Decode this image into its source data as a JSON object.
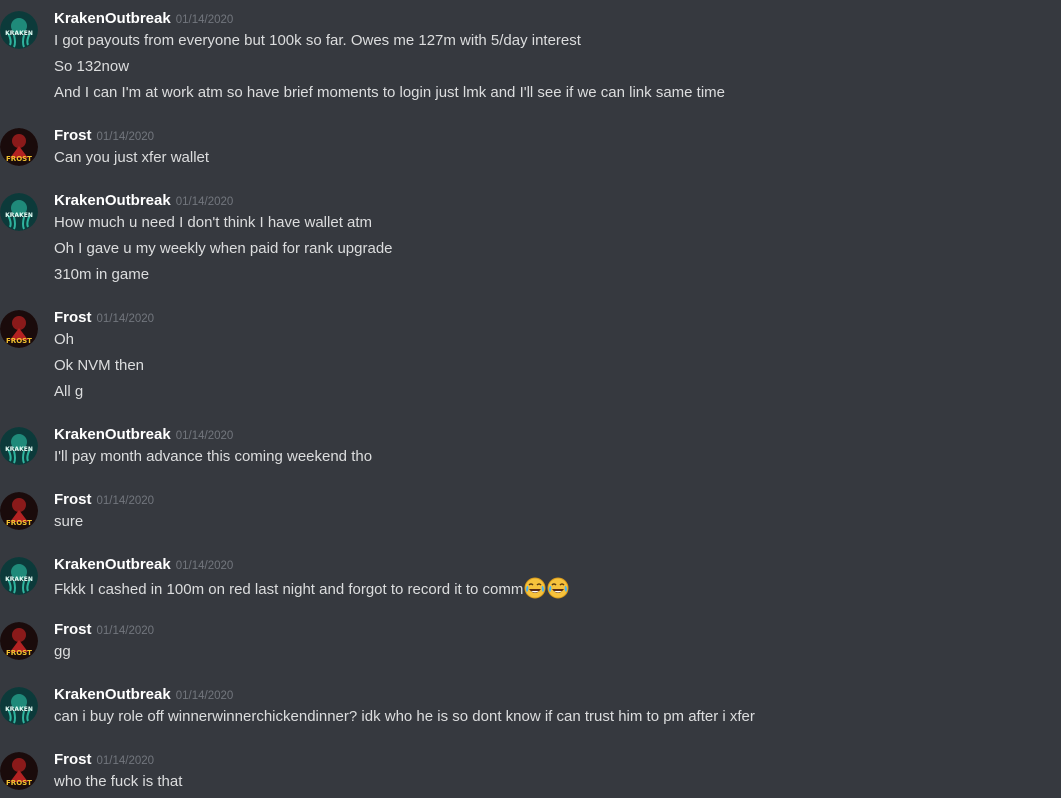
{
  "users": {
    "kraken": {
      "name": "KrakenOutbreak",
      "avatar_icon": "kraken-avatar-icon",
      "avatar_text": "KRAKEN"
    },
    "frost": {
      "name": "Frost",
      "avatar_icon": "frost-avatar-icon",
      "avatar_text": "FROST"
    }
  },
  "messages": [
    {
      "author": "KrakenOutbreak",
      "time": "01/14/2020",
      "lines": [
        "I got payouts from everyone but 100k so far. Owes me 127m with 5/day interest",
        "So 132now",
        "And I can I'm at work atm so have brief moments to login just lmk and I'll see if we can link same time"
      ]
    },
    {
      "author": "Frost",
      "time": "01/14/2020",
      "lines": [
        "Can you just xfer wallet"
      ]
    },
    {
      "author": "KrakenOutbreak",
      "time": "01/14/2020",
      "lines": [
        "How much u need I don't think I have wallet atm",
        "Oh I gave u my weekly when paid for rank upgrade",
        "310m in game"
      ]
    },
    {
      "author": "Frost",
      "time": "01/14/2020",
      "lines": [
        "Oh",
        "Ok NVM then",
        "All g"
      ]
    },
    {
      "author": "KrakenOutbreak",
      "time": "01/14/2020",
      "lines": [
        "I'll pay month advance this coming weekend tho"
      ]
    },
    {
      "author": "Frost",
      "time": "01/14/2020",
      "lines": [
        "sure"
      ]
    },
    {
      "author": "KrakenOutbreak",
      "time": "01/14/2020",
      "lines": [
        "Fkkk I cashed in 100m on red last night and forgot to record it to comm"
      ],
      "emojis": [
        "face-with-tears-of-joy-icon",
        "face-with-tears-of-joy-icon"
      ]
    },
    {
      "author": "Frost",
      "time": "01/14/2020",
      "lines": [
        "gg"
      ]
    },
    {
      "author": "KrakenOutbreak",
      "time": "01/14/2020",
      "lines": [
        "can i buy role off winnerwinnerchickendinner? idk who he is so dont know if can trust him to pm after i xfer"
      ]
    },
    {
      "author": "Frost",
      "time": "01/14/2020",
      "lines": [
        "who the fuck is that"
      ]
    }
  ]
}
